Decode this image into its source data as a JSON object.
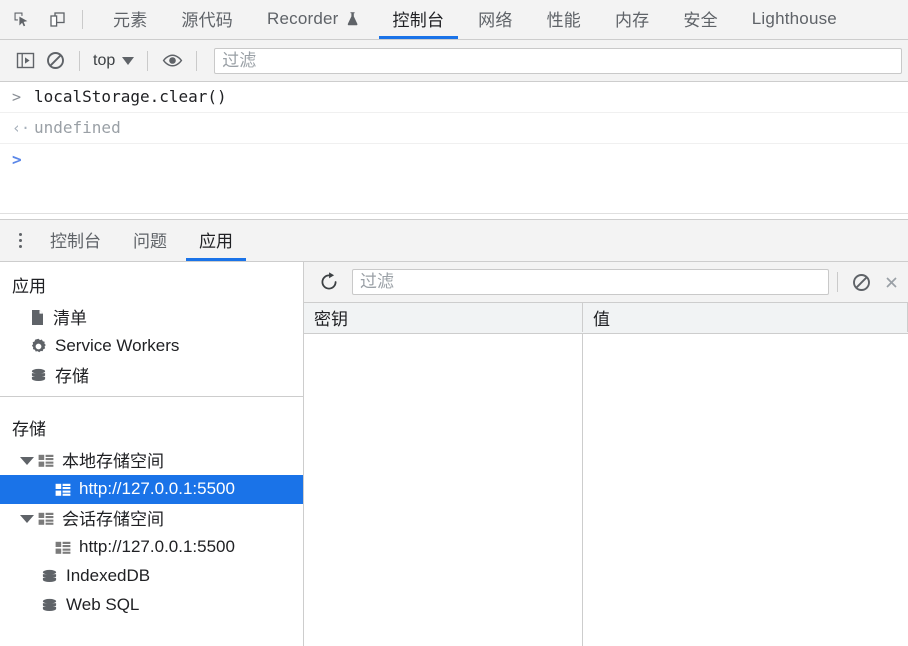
{
  "devtools": {
    "toolbar_icons": [
      {
        "name": "inspect-element-icon",
        "title": "检查元素"
      },
      {
        "name": "device-toolbar-icon",
        "title": "切换设备工具栏"
      }
    ],
    "tabs": [
      {
        "label": "元素",
        "active": false,
        "experimental": false
      },
      {
        "label": "源代码",
        "active": false,
        "experimental": false
      },
      {
        "label": "Recorder",
        "active": false,
        "experimental": true
      },
      {
        "label": "控制台",
        "active": true,
        "experimental": false
      },
      {
        "label": "网络",
        "active": false,
        "experimental": false
      },
      {
        "label": "性能",
        "active": false,
        "experimental": false
      },
      {
        "label": "内存",
        "active": false,
        "experimental": false
      },
      {
        "label": "安全",
        "active": false,
        "experimental": false
      },
      {
        "label": "Lighthouse",
        "active": false,
        "experimental": false
      }
    ],
    "active_tab_color": "#1a73e8"
  },
  "console": {
    "toolbar": {
      "sidebar_toggle": "console-sidebar-icon",
      "clear_label": "clear-console-icon",
      "context_value": "top",
      "eye_label": "live-expression-icon",
      "filter_placeholder": "过滤",
      "filter_value": ""
    },
    "messages": [
      {
        "type": "input",
        "gutter": ">",
        "text": "localStorage.clear()"
      },
      {
        "type": "output",
        "gutter": "‹·",
        "text": "undefined"
      }
    ],
    "prompt": {
      "gutter": ">",
      "value": ""
    }
  },
  "drawer": {
    "tabs": [
      {
        "label": "控制台",
        "active": false
      },
      {
        "label": "问题",
        "active": false
      },
      {
        "label": "应用",
        "active": true
      }
    ],
    "more_label": "more-tabs-icon"
  },
  "application": {
    "sections": [
      {
        "title": "应用",
        "items": [
          {
            "label": "清单",
            "icon": "manifest-file-icon",
            "selected": false
          },
          {
            "label": "Service Workers",
            "icon": "gear-icon",
            "selected": false
          },
          {
            "label": "存储",
            "icon": "database-icon",
            "selected": false
          }
        ]
      },
      {
        "title": "存储",
        "items": [
          {
            "label": "本地存储空间",
            "icon": "storage-grid-icon",
            "expandable": true,
            "expanded": true,
            "depth": 0,
            "selected": false
          },
          {
            "label": "http://127.0.0.1:5500",
            "icon": "storage-grid-icon",
            "expandable": false,
            "depth": 1,
            "selected": true
          },
          {
            "label": "会话存储空间",
            "icon": "storage-grid-icon",
            "expandable": true,
            "expanded": true,
            "depth": 0,
            "selected": false
          },
          {
            "label": "http://127.0.0.1:5500",
            "icon": "storage-grid-icon",
            "expandable": false,
            "depth": 1,
            "selected": false
          },
          {
            "label": "IndexedDB",
            "icon": "database-icon",
            "expandable": false,
            "depth": 0,
            "selected": false
          },
          {
            "label": "Web SQL",
            "icon": "database-icon",
            "expandable": false,
            "depth": 0,
            "selected": false
          }
        ]
      }
    ],
    "selection_color": "#1a73e8"
  },
  "storage_panel": {
    "toolbar": {
      "refresh_label": "refresh-icon",
      "filter_placeholder": "过滤",
      "filter_value": "",
      "clear_all_label": "clear-all-icon",
      "delete_selected_label": "delete-selected-icon"
    },
    "table": {
      "columns": [
        "密钥",
        "值"
      ],
      "rows": []
    }
  }
}
